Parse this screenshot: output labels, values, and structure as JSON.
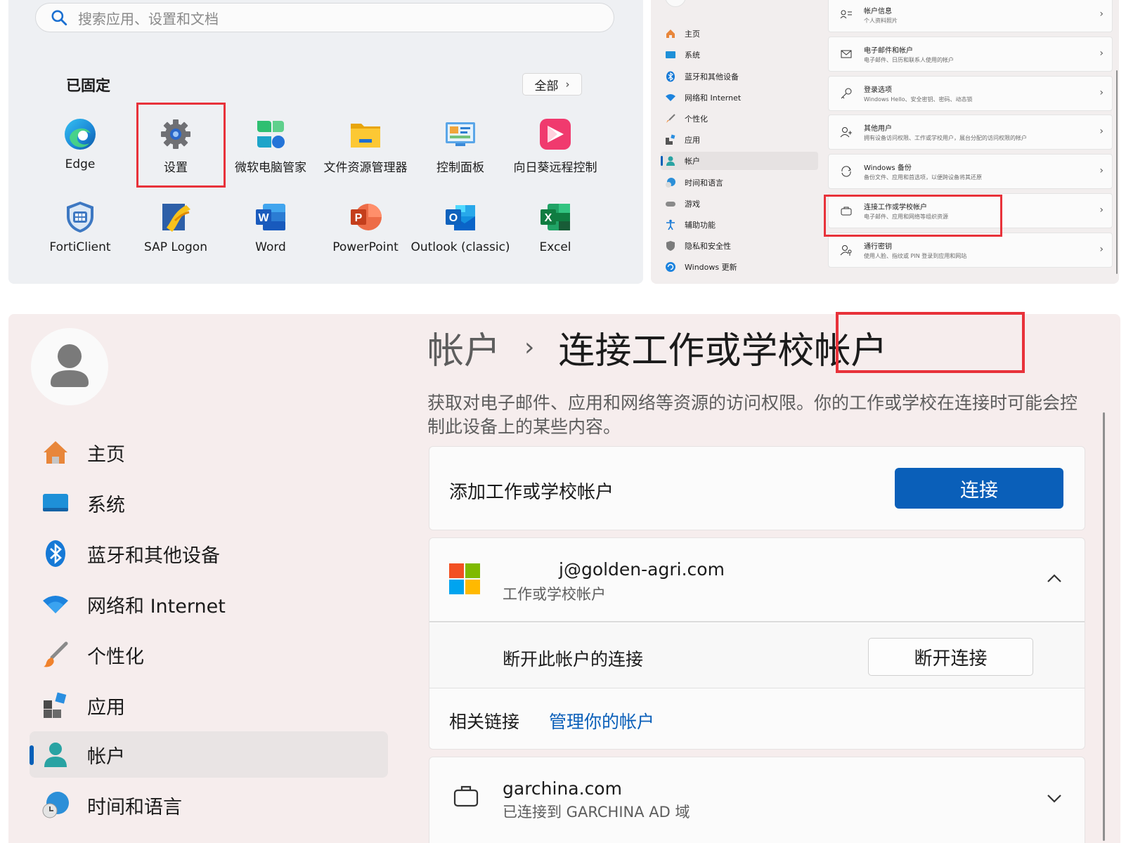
{
  "start_menu": {
    "search_placeholder": "搜索应用、设置和文档",
    "pinned_title": "已固定",
    "all_button": "全部",
    "apps": [
      {
        "label": "Edge",
        "icon": "edge-icon"
      },
      {
        "label": "设置",
        "icon": "settings-gear-icon"
      },
      {
        "label": "微软电脑管家",
        "icon": "pc-manager-icon"
      },
      {
        "label": "文件资源管理器",
        "icon": "file-explorer-icon"
      },
      {
        "label": "控制面板",
        "icon": "control-panel-icon"
      },
      {
        "label": "向日葵远程控制",
        "icon": "sunlogin-icon"
      },
      {
        "label": "FortiClient",
        "icon": "forticlient-icon"
      },
      {
        "label": "SAP Logon",
        "icon": "sap-logon-icon"
      },
      {
        "label": "Word",
        "icon": "word-icon"
      },
      {
        "label": "PowerPoint",
        "icon": "powerpoint-icon"
      },
      {
        "label": "Outlook (classic)",
        "icon": "outlook-icon"
      },
      {
        "label": "Excel",
        "icon": "excel-icon"
      }
    ]
  },
  "settings_small": {
    "nav": [
      {
        "label": "主页",
        "icon": "home-icon"
      },
      {
        "label": "系统",
        "icon": "system-icon"
      },
      {
        "label": "蓝牙和其他设备",
        "icon": "bluetooth-icon"
      },
      {
        "label": "网络和 Internet",
        "icon": "wifi-icon"
      },
      {
        "label": "个性化",
        "icon": "brush-icon"
      },
      {
        "label": "应用",
        "icon": "apps-icon"
      },
      {
        "label": "帐户",
        "icon": "account-icon"
      },
      {
        "label": "时间和语言",
        "icon": "time-language-icon"
      },
      {
        "label": "游戏",
        "icon": "gaming-icon"
      },
      {
        "label": "辅助功能",
        "icon": "accessibility-icon"
      },
      {
        "label": "隐私和安全性",
        "icon": "shield-icon"
      },
      {
        "label": "Windows 更新",
        "icon": "update-icon"
      }
    ],
    "cards": [
      {
        "title": "帐户信息",
        "subtitle": "个人资料照片",
        "icon": "account-info-icon"
      },
      {
        "title": "电子邮件和帐户",
        "subtitle": "电子邮件、日历和联系人使用的帐户",
        "icon": "mail-icon"
      },
      {
        "title": "登录选项",
        "subtitle": "Windows Hello、安全密钥、密码、动态锁",
        "icon": "key-icon"
      },
      {
        "title": "其他用户",
        "subtitle": "拥有设备访问权限、工作或学校用户，展台分配的访问权限的帐户",
        "icon": "other-users-icon"
      },
      {
        "title": "Windows 备份",
        "subtitle": "备份文件、应用和首选项，以便跨设备将其还原",
        "icon": "backup-icon"
      },
      {
        "title": "连接工作或学校帐户",
        "subtitle": "电子邮件、应用和网络等组织资源",
        "icon": "briefcase-icon"
      },
      {
        "title": "通行密钥",
        "subtitle": "使用人脸、指纹或 PIN 登录到应用和网站",
        "icon": "passkey-icon"
      }
    ]
  },
  "settings_large": {
    "nav": [
      {
        "label": "主页",
        "icon": "home-icon"
      },
      {
        "label": "系统",
        "icon": "system-icon"
      },
      {
        "label": "蓝牙和其他设备",
        "icon": "bluetooth-icon"
      },
      {
        "label": "网络和 Internet",
        "icon": "wifi-icon"
      },
      {
        "label": "个性化",
        "icon": "brush-icon"
      },
      {
        "label": "应用",
        "icon": "apps-icon"
      },
      {
        "label": "帐户",
        "icon": "account-icon"
      },
      {
        "label": "时间和语言",
        "icon": "time-language-icon"
      }
    ],
    "breadcrumb_parent": "帐户",
    "breadcrumb_sep": "›",
    "breadcrumb_current": "连接工作或学校帐户",
    "description": "获取对电子邮件、应用和网络等资源的访问权限。你的工作或学校在连接时可能会控制此设备上的某些内容。",
    "add_account_label": "添加工作或学校帐户",
    "connect_button": "连接",
    "account1": {
      "email": "j@golden-agri.com",
      "type": "工作或学校帐户",
      "icon": "microsoft-logo-icon"
    },
    "disconnect_label": "断开此帐户的连接",
    "disconnect_button": "断开连接",
    "related_label": "相关链接",
    "manage_link": "管理你的帐户",
    "account2": {
      "domain": "garchina.com",
      "status": "已连接到 GARCHINA AD 域",
      "icon": "briefcase-icon"
    }
  },
  "colors": {
    "accent": "#0a5fb9",
    "highlight": "#e8323a"
  }
}
